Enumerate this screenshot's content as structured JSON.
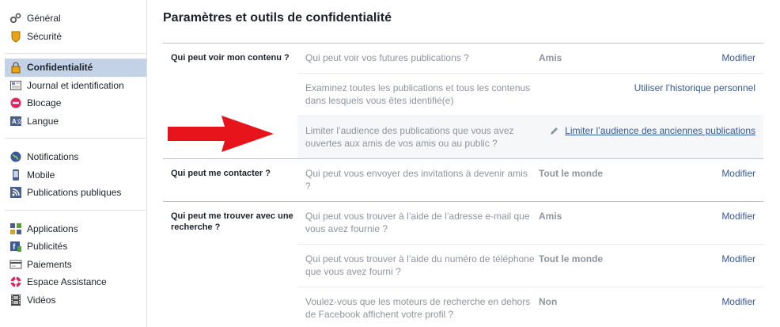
{
  "sidebar": {
    "groups": [
      [
        {
          "label": "Général",
          "icon": "gears-icon"
        },
        {
          "label": "Sécurité",
          "icon": "badge-icon"
        }
      ],
      [
        {
          "label": "Confidentialité",
          "icon": "lock-icon",
          "active": true
        },
        {
          "label": "Journal et identification",
          "icon": "timeline-icon"
        },
        {
          "label": "Blocage",
          "icon": "block-icon"
        },
        {
          "label": "Langue",
          "icon": "language-icon"
        }
      ],
      [
        {
          "label": "Notifications",
          "icon": "globe-icon"
        },
        {
          "label": "Mobile",
          "icon": "mobile-icon"
        },
        {
          "label": "Publications publiques",
          "icon": "rss-icon"
        }
      ],
      [
        {
          "label": "Applications",
          "icon": "apps-icon"
        },
        {
          "label": "Publicités",
          "icon": "ads-icon"
        },
        {
          "label": "Paiements",
          "icon": "payments-icon"
        },
        {
          "label": "Espace Assistance",
          "icon": "lifebuoy-icon"
        },
        {
          "label": "Vidéos",
          "icon": "film-icon"
        }
      ]
    ]
  },
  "main": {
    "title": "Paramètres et outils de confidentialité",
    "sections": [
      {
        "label": "Qui peut voir mon contenu ?",
        "rows": [
          {
            "question": "Qui peut voir vos futures publications ?",
            "value": "Amis",
            "action": "Modifier"
          },
          {
            "question": "Examinez toutes les publications et tous les contenus dans lesquels vous êtes identifié(e)",
            "value": "",
            "action": "Utiliser l’historique personnel"
          },
          {
            "question": "Limiter l’audience des publications que vous avez ouvertes aux amis de vos amis ou au public ?",
            "value": "",
            "action": "Limiter l’audience des anciennes publications",
            "highlight": true
          }
        ]
      },
      {
        "label": "Qui peut me contacter ?",
        "rows": [
          {
            "question": "Qui peut vous envoyer des invitations à devenir amis ?",
            "value": "Tout le monde",
            "action": "Modifier"
          }
        ]
      },
      {
        "label": "Qui peut me trouver avec une recherche ?",
        "rows": [
          {
            "question": "Qui peut vous trouver à l’aide de l’adresse e-mail que vous avez fournie ?",
            "value": "Amis",
            "action": "Modifier"
          },
          {
            "question": "Qui peut vous trouver à l’aide du numéro de téléphone que vous avez fourni ?",
            "value": "Tout le monde",
            "action": "Modifier"
          },
          {
            "question": "Voulez-vous que les moteurs de recherche en dehors de Facebook affichent votre profil ?",
            "value": "Non",
            "action": "Modifier"
          }
        ]
      }
    ]
  },
  "colors": {
    "link": "#365899",
    "active_bg": "#c4d2e7",
    "arrow": "#e8141c",
    "muted": "#90949c"
  }
}
